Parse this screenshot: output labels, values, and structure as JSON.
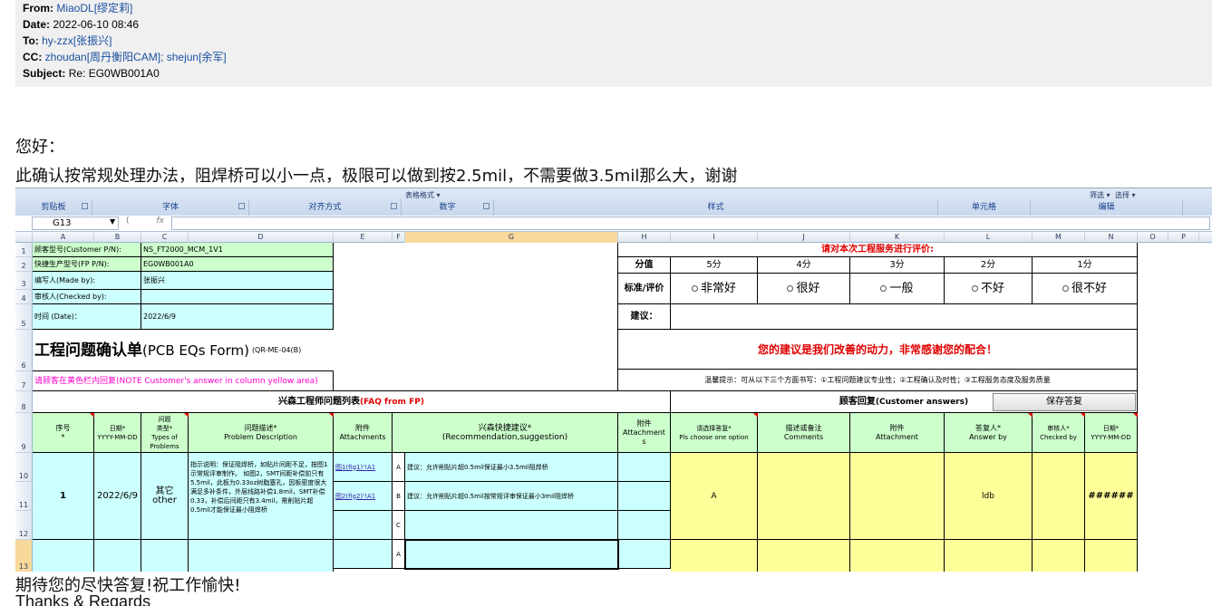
{
  "email": {
    "from_label": "From:",
    "from_value": "MiaoDL[缪定莉]",
    "date_label": "Date:",
    "date_value": "2022-06-10 08:46",
    "to_label": "To:",
    "to_value": "hy-zzx[张振兴]",
    "cc_label": "CC:",
    "cc_value_1": "zhoudan[周丹衡阳CAM]",
    "cc_sep": "; ",
    "cc_value_2": "shejun[余军]",
    "subject_label": "Subject:",
    "subject_value": "Re: EG0WB001A0"
  },
  "body": {
    "greeting": "您好：",
    "line1": "此确认按常规处理办法，阻焊桥可以小一点，极限可以做到按2.5mil，不需要做3.5mil那么大，谢谢",
    "closing": "期待您的尽快答复!祝工作愉快!",
    "signoff": "Thanks & Regards"
  },
  "excel": {
    "ribbon_groups": [
      "剪贴板",
      "字体",
      "对齐方式",
      "数字",
      "样式",
      "单元格",
      "编辑"
    ],
    "ribbon_controls": {
      "table_format": "表格格式 ▾",
      "filter": "筛选 ▾",
      "select": "选择 ▾"
    },
    "name_box": "G13",
    "fx": "fx",
    "columns": [
      "A",
      "B",
      "C",
      "D",
      "E",
      "F",
      "G",
      "H",
      "I",
      "J",
      "K",
      "L",
      "M",
      "N",
      "O",
      "P"
    ],
    "selected_col": "G",
    "rows": [
      "1",
      "2",
      "3",
      "4",
      "5",
      "6",
      "7",
      "8",
      "9",
      "10",
      "11",
      "12",
      "13"
    ],
    "selected_row": "13",
    "info": {
      "customer_pn_label": "顾客型号(Customer P/N):",
      "customer_pn": "NS_FT2000_MCM_1V1",
      "fp_pn_label": "快捷生产型号(FP P/N):",
      "fp_pn": "EG0WB001A0",
      "made_by_label": "编写人(Made by):",
      "made_by": "张振兴",
      "checked_by_label": "审核人(Checked by):",
      "date_label": "时间 (Date)：",
      "date": "2022/6/9",
      "form_title_cn": "工程问题确认单",
      "form_title_en": "(PCB EQs Form)",
      "form_code": "(QR-ME-04(B)",
      "note": "请顾客在黄色栏内回复(NOTE Customer's answer in column yellow area)"
    },
    "rating": {
      "title": "请对本次工程服务进行评价:",
      "score_label": "分值",
      "scores": [
        "5分",
        "4分",
        "3分",
        "2分",
        "1分"
      ],
      "std_label": "标准/评价",
      "options": [
        "非常好",
        "很好",
        "一般",
        "不好",
        "很不好"
      ],
      "suggest_label": "建议：",
      "thanks": "您的建议是我们改善的动力，非常感谢您的配合！",
      "tips": "温馨提示：可从以下三个方面书写：①工程问题建议专业性；②工程确认及时性；③工程服务态度及服务质量"
    },
    "table": {
      "fp_title": "兴森工程师问题列表",
      "fp_title_en": "(FAQ from FP)",
      "cust_title": "顾客回复",
      "cust_title_en": "(Customer answers)",
      "save_button": "保存答复",
      "headers": {
        "seq": "序号\n*",
        "date": "日期*\nYYYY-MM-DD",
        "type": "问题\n类型*\nTypes of\nProblems",
        "desc": "问题描述*\nProblem Description",
        "attach": "附件\nAttachments",
        "recommend": "兴森快捷建议*\n(Recommendation,suggestion)",
        "attach2": "附件\nAttachment\ns",
        "choose": "请选择答复*\nPls choose one option",
        "comments": "描述或备注\nComments",
        "attach3": "附件\nAttachment",
        "answer_by": "答复人*\nAnswer by",
        "checked_by": "审核人*\nChecked by",
        "date2": "日期*\nYYYY-MM-DD"
      },
      "row1": {
        "seq": "1",
        "date": "2022/6/9",
        "type": "其它\nother",
        "desc": "指示说明：保证阻焊桥，如贴片间距不足，按图1示常规评审制作。 如图2，SMT间距补偿前只有5.5mil，此板为0.33oz树脂塞孔，因板密度很大满足多补条件，外层线路补偿1.8mil，SMT补偿0.33，补偿后间距只有3.4mil，需削贴片超0.5mil才能保证最小阻焊桥",
        "attach_a": "图1(fig1)'!A1",
        "attach_b": "图2(fig2)'!A1",
        "opt_a": "A",
        "opt_b": "B",
        "opt_c": "C",
        "rec_a": "建议：允许削贴片超0.5mil保证最小3.5mil阻焊桥",
        "rec_b": "建议：允许削贴片超0.5mil按常规评审保证最小3mil阻焊桥",
        "choice": "A",
        "answer_by": "ldb",
        "date2": "######"
      },
      "row2": {
        "opt_a": "A"
      }
    }
  }
}
